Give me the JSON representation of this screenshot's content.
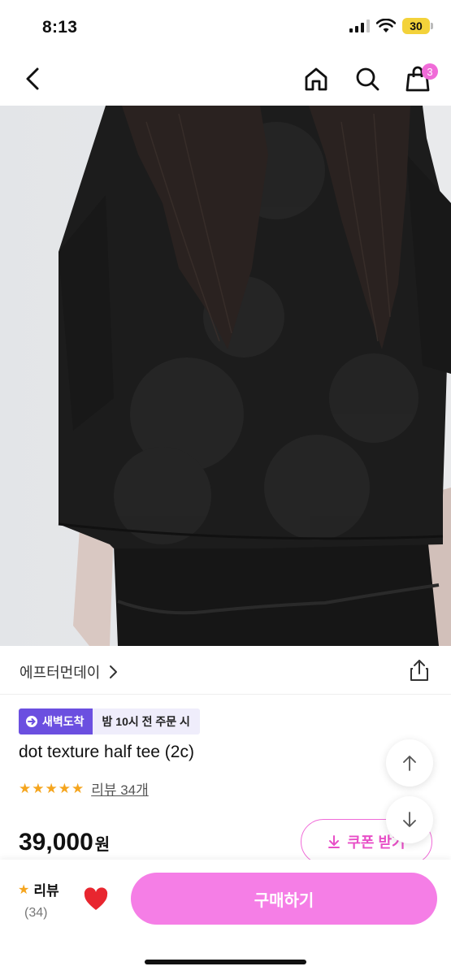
{
  "status": {
    "time": "8:13",
    "battery": "30"
  },
  "nav": {
    "cart_count": "3"
  },
  "brand": {
    "name": "에프터먼데이"
  },
  "delivery": {
    "badge": "새벽도착",
    "cutoff": "밤 10시 전 주문 시"
  },
  "product": {
    "title": "dot texture half tee (2c)",
    "stars": "★★★★★",
    "review_link": "리뷰 34개",
    "price": "39,000",
    "price_unit": "원"
  },
  "coupon": {
    "label": "쿠폰 받기"
  },
  "bottom": {
    "review_label": "리뷰",
    "review_count": "(34)",
    "buy_label": "구매하기"
  },
  "colors": {
    "accent": "#f57ee6",
    "dawn_badge": "#6b4fe0",
    "star": "#f5a51e"
  }
}
